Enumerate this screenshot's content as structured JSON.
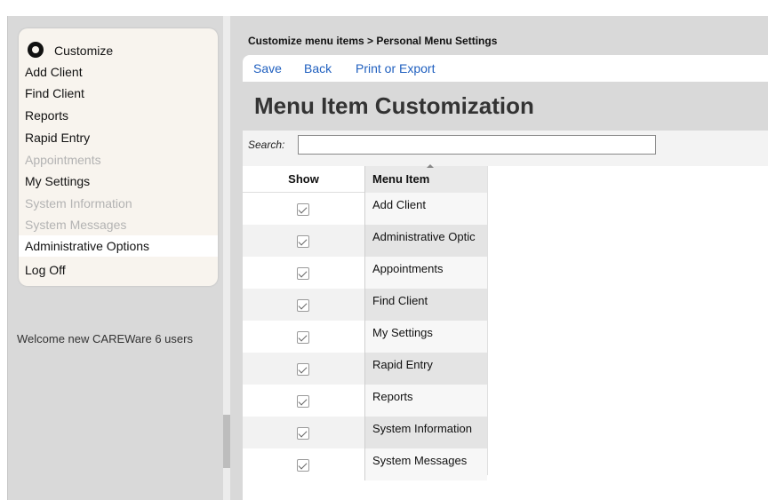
{
  "sidebar": {
    "customize_label": "Customize",
    "items": [
      {
        "label": "Add Client"
      },
      {
        "label": "Find Client"
      },
      {
        "label": "Reports"
      },
      {
        "label": "Rapid Entry"
      },
      {
        "label": "Appointments"
      },
      {
        "label": "My Settings"
      },
      {
        "label": "System Information"
      },
      {
        "label": "System Messages"
      },
      {
        "label": "Administrative Options"
      },
      {
        "label": "Log Off"
      }
    ],
    "welcome_text": "Welcome new CAREWare 6 users"
  },
  "main": {
    "breadcrumb": "Customize menu items > Personal Menu Settings",
    "toolbar": {
      "save_label": "Save",
      "back_label": "Back",
      "print_label": "Print or Export"
    },
    "title": "Menu Item Customization",
    "search": {
      "label": "Search:",
      "value": ""
    },
    "table": {
      "columns": [
        "Show",
        "Menu Item"
      ],
      "rows": [
        {
          "show": true,
          "item": "Add Client"
        },
        {
          "show": true,
          "item": "Administrative Optic"
        },
        {
          "show": true,
          "item": "Appointments"
        },
        {
          "show": true,
          "item": "Find Client"
        },
        {
          "show": true,
          "item": "My Settings"
        },
        {
          "show": true,
          "item": "Rapid Entry"
        },
        {
          "show": true,
          "item": "Reports"
        },
        {
          "show": true,
          "item": "System Information"
        },
        {
          "show": true,
          "item": "System Messages"
        }
      ]
    }
  },
  "colors": {
    "link": "#1f5fbf",
    "panel": "#d9d9d9",
    "menu_bg": "#f8f4ee"
  }
}
